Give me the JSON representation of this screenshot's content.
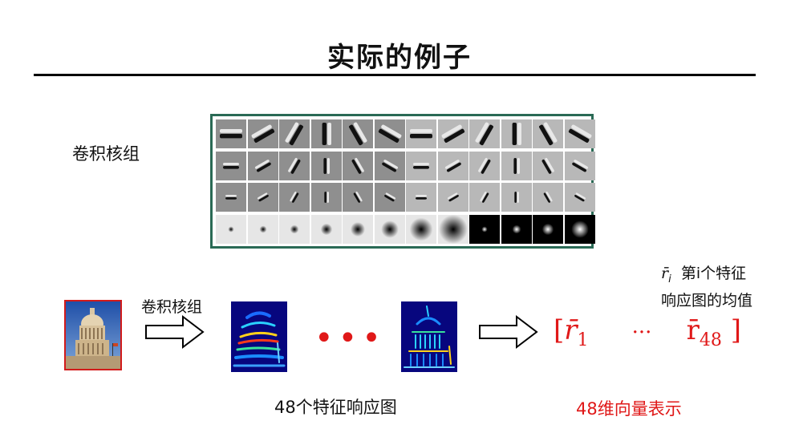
{
  "title": "实际的例子",
  "filter_bank": {
    "label": "卷积核组"
  },
  "note": {
    "symbol": "r̄",
    "symbol_sub": "i",
    "line1": "第i个特征",
    "line2": "响应图的均值"
  },
  "pipeline": {
    "arrow_label": "卷积核组",
    "dots": "•••"
  },
  "vector": {
    "open": "[",
    "first": "r̄",
    "first_sub": "1",
    "ellipsis": "···",
    "last": "r̄",
    "last_sub": "48",
    "close": "]"
  },
  "captions": {
    "maps": "48个特征响应图",
    "vector": "48维向量表示"
  },
  "colors": {
    "accent_red": "#e01818",
    "frame_green": "#2a6a55"
  }
}
